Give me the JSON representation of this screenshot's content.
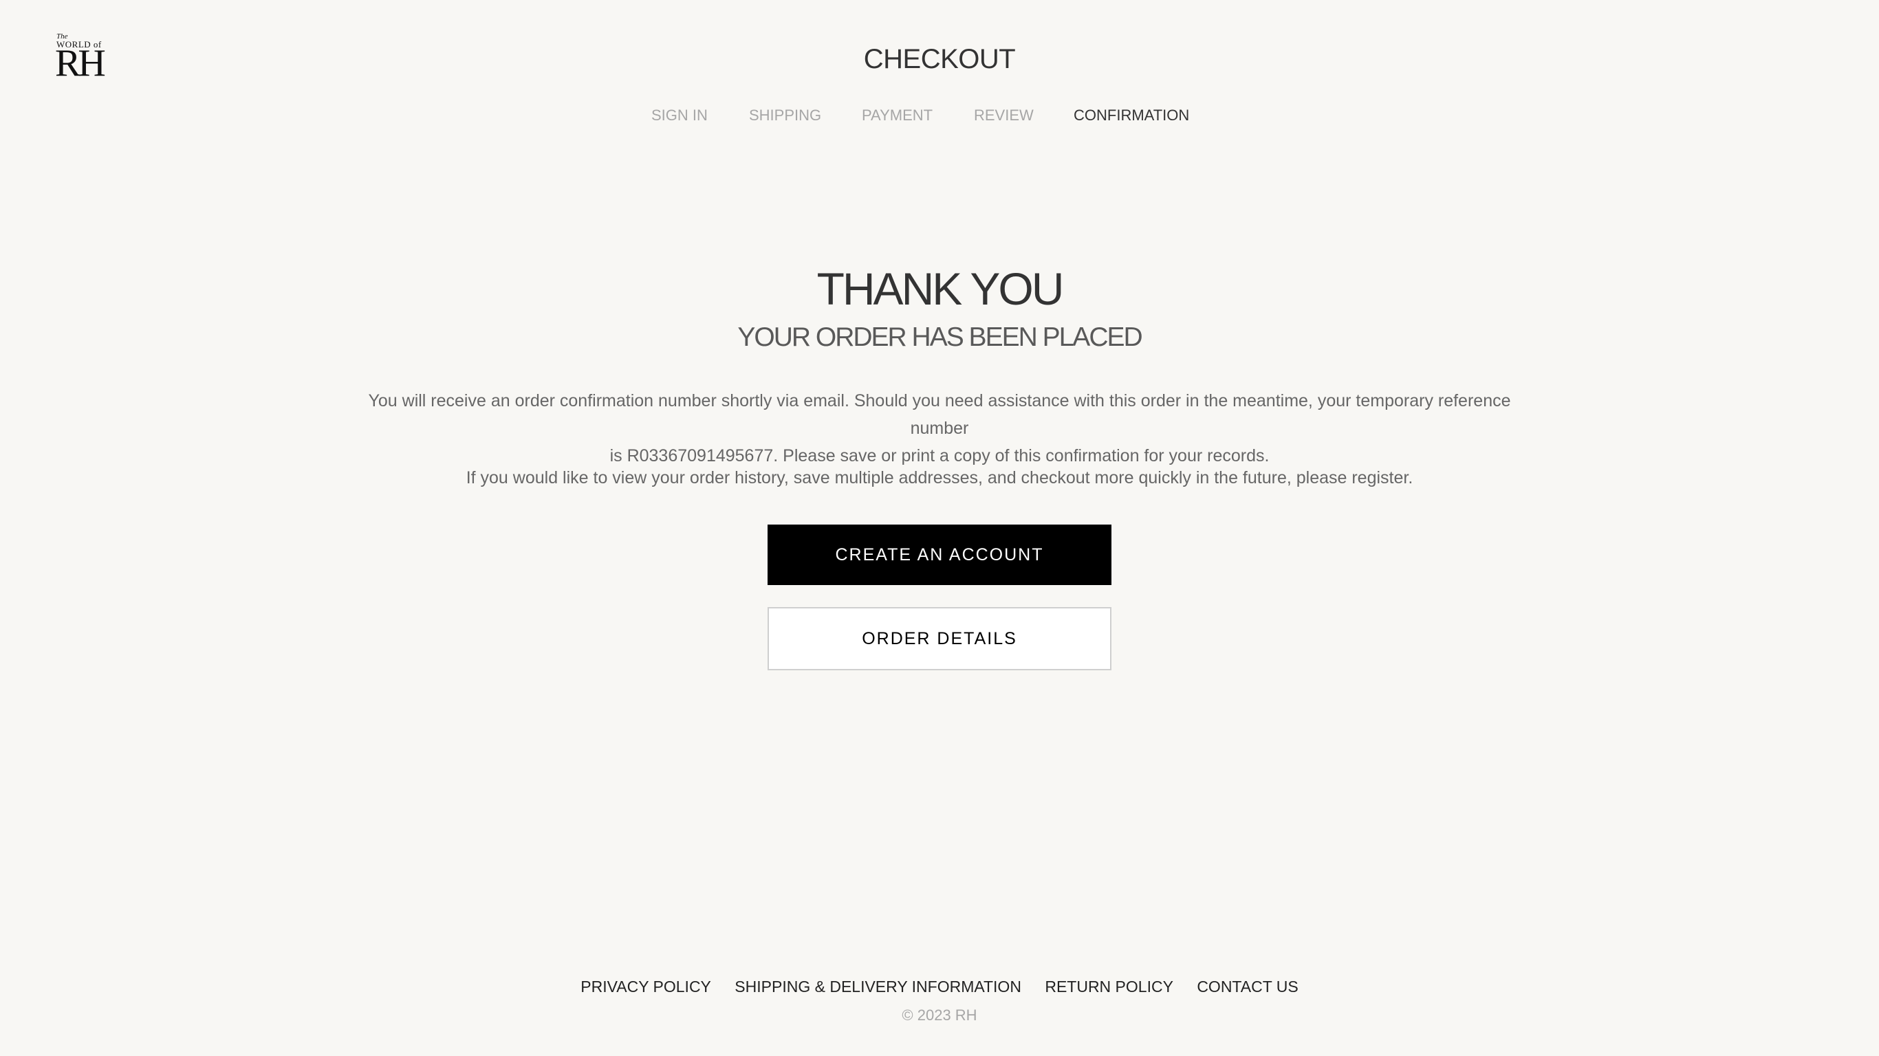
{
  "header": {
    "logo": {
      "the": "The",
      "world": "WORLD of",
      "rh": "RH"
    },
    "title": "CHECKOUT"
  },
  "steps": [
    {
      "label": "SIGN IN",
      "active": false
    },
    {
      "label": "SHIPPING",
      "active": false
    },
    {
      "label": "PAYMENT",
      "active": false
    },
    {
      "label": "REVIEW",
      "active": false
    },
    {
      "label": "CONFIRMATION",
      "active": true
    }
  ],
  "main": {
    "title": "THANK YOU",
    "subtitle": "YOUR ORDER HAS BEEN PLACED",
    "message_line1": "You will receive an order confirmation number shortly via email. Should you need assistance with this order in the meantime, your temporary reference number",
    "message_line2": "is R03367091495677. Please save or print a copy of this confirmation for your records.",
    "register_message": "If you would like to view your order history, save multiple addresses, and checkout more quickly in the future, please register.",
    "create_account_label": "CREATE AN ACCOUNT",
    "order_details_label": "ORDER DETAILS"
  },
  "footer": {
    "links": [
      "PRIVACY POLICY",
      "SHIPPING & DELIVERY INFORMATION",
      "RETURN POLICY",
      "CONTACT US"
    ],
    "copyright": "© 2023 RH"
  },
  "colors": {
    "background": "#f8f7f4",
    "primary_button": "#000000",
    "inactive_step": "#a6a6a6",
    "text": "#333333"
  }
}
